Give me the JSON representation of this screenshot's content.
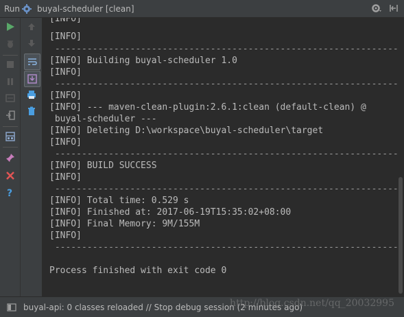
{
  "window": {
    "tool_label": "Run",
    "config_name": "buyal-scheduler [clean]"
  },
  "left_toolbar_1": [
    {
      "icon": "run-icon",
      "color": "#59a869"
    },
    {
      "icon": "debug-icon",
      "color": "#777777"
    },
    {
      "icon": "stop-icon",
      "color": "#777777"
    },
    {
      "icon": "pause-icon",
      "color": "#777777"
    },
    {
      "icon": "dump-threads-icon",
      "color": "#777777"
    },
    {
      "icon": "exit-icon",
      "color": "#777777"
    },
    {
      "icon": "layout-icon",
      "color": "#8aa4c8"
    },
    {
      "icon": "pin-icon",
      "color": "#c77dbb"
    },
    {
      "icon": "close-icon",
      "color": "#e05555"
    },
    {
      "icon": "help-icon",
      "color": "#4a9ee0"
    }
  ],
  "left_toolbar_2": [
    {
      "icon": "up-arrow-icon"
    },
    {
      "icon": "down-arrow-icon"
    },
    {
      "icon": "soft-wrap-icon"
    },
    {
      "icon": "scroll-to-end-icon"
    },
    {
      "icon": "print-icon"
    },
    {
      "icon": "trash-icon"
    }
  ],
  "console": {
    "lines": [
      "[INFO]",
      "[INFO] Building buyal-scheduler 1.0",
      "[INFO]",
      "[INFO]",
      "[INFO] --- maven-clean-plugin:2.6.1:clean (default-clean) @",
      " buyal-scheduler ---",
      "[INFO] Deleting D:\\workspace\\buyal-scheduler\\target",
      "[INFO]",
      "[INFO] BUILD SUCCESS",
      "[INFO]",
      "[INFO] Total time: 0.529 s",
      "[INFO] Finished at: 2017-06-19T15:35:02+08:00",
      "[INFO] Final Memory: 9M/155M",
      "[INFO]",
      "Process finished with exit code 0"
    ],
    "separator": " ------------------------------------------------------------------------"
  },
  "status": {
    "text": "buyal-api: 0 classes reloaded // Stop debug session (2 minutes ago)"
  },
  "watermark": "http://blog.csdn.net/qq_20032995"
}
